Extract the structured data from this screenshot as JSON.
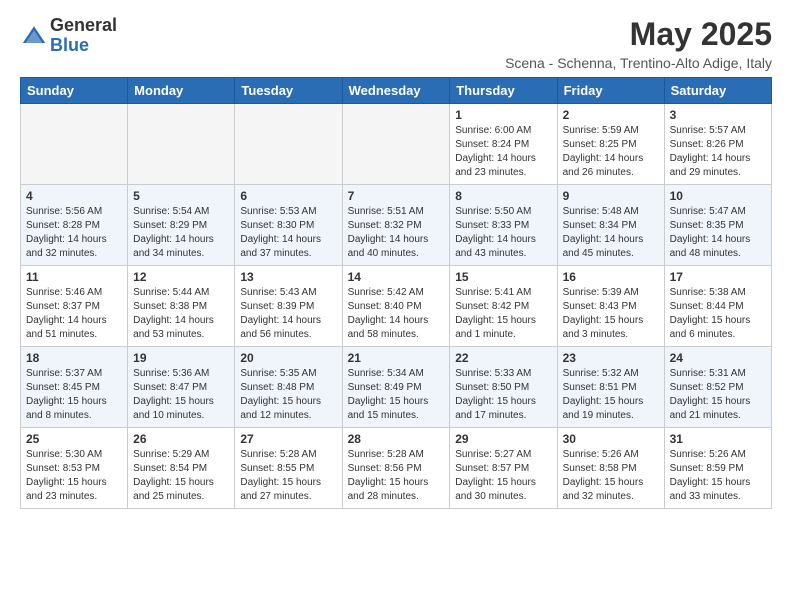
{
  "logo": {
    "general": "General",
    "blue": "Blue"
  },
  "header": {
    "month_title": "May 2025",
    "subtitle": "Scena - Schenna, Trentino-Alto Adige, Italy"
  },
  "weekdays": [
    "Sunday",
    "Monday",
    "Tuesday",
    "Wednesday",
    "Thursday",
    "Friday",
    "Saturday"
  ],
  "weeks": [
    [
      {
        "day": "",
        "info": ""
      },
      {
        "day": "",
        "info": ""
      },
      {
        "day": "",
        "info": ""
      },
      {
        "day": "",
        "info": ""
      },
      {
        "day": "1",
        "info": "Sunrise: 6:00 AM\nSunset: 8:24 PM\nDaylight: 14 hours\nand 23 minutes."
      },
      {
        "day": "2",
        "info": "Sunrise: 5:59 AM\nSunset: 8:25 PM\nDaylight: 14 hours\nand 26 minutes."
      },
      {
        "day": "3",
        "info": "Sunrise: 5:57 AM\nSunset: 8:26 PM\nDaylight: 14 hours\nand 29 minutes."
      }
    ],
    [
      {
        "day": "4",
        "info": "Sunrise: 5:56 AM\nSunset: 8:28 PM\nDaylight: 14 hours\nand 32 minutes."
      },
      {
        "day": "5",
        "info": "Sunrise: 5:54 AM\nSunset: 8:29 PM\nDaylight: 14 hours\nand 34 minutes."
      },
      {
        "day": "6",
        "info": "Sunrise: 5:53 AM\nSunset: 8:30 PM\nDaylight: 14 hours\nand 37 minutes."
      },
      {
        "day": "7",
        "info": "Sunrise: 5:51 AM\nSunset: 8:32 PM\nDaylight: 14 hours\nand 40 minutes."
      },
      {
        "day": "8",
        "info": "Sunrise: 5:50 AM\nSunset: 8:33 PM\nDaylight: 14 hours\nand 43 minutes."
      },
      {
        "day": "9",
        "info": "Sunrise: 5:48 AM\nSunset: 8:34 PM\nDaylight: 14 hours\nand 45 minutes."
      },
      {
        "day": "10",
        "info": "Sunrise: 5:47 AM\nSunset: 8:35 PM\nDaylight: 14 hours\nand 48 minutes."
      }
    ],
    [
      {
        "day": "11",
        "info": "Sunrise: 5:46 AM\nSunset: 8:37 PM\nDaylight: 14 hours\nand 51 minutes."
      },
      {
        "day": "12",
        "info": "Sunrise: 5:44 AM\nSunset: 8:38 PM\nDaylight: 14 hours\nand 53 minutes."
      },
      {
        "day": "13",
        "info": "Sunrise: 5:43 AM\nSunset: 8:39 PM\nDaylight: 14 hours\nand 56 minutes."
      },
      {
        "day": "14",
        "info": "Sunrise: 5:42 AM\nSunset: 8:40 PM\nDaylight: 14 hours\nand 58 minutes."
      },
      {
        "day": "15",
        "info": "Sunrise: 5:41 AM\nSunset: 8:42 PM\nDaylight: 15 hours\nand 1 minute."
      },
      {
        "day": "16",
        "info": "Sunrise: 5:39 AM\nSunset: 8:43 PM\nDaylight: 15 hours\nand 3 minutes."
      },
      {
        "day": "17",
        "info": "Sunrise: 5:38 AM\nSunset: 8:44 PM\nDaylight: 15 hours\nand 6 minutes."
      }
    ],
    [
      {
        "day": "18",
        "info": "Sunrise: 5:37 AM\nSunset: 8:45 PM\nDaylight: 15 hours\nand 8 minutes."
      },
      {
        "day": "19",
        "info": "Sunrise: 5:36 AM\nSunset: 8:47 PM\nDaylight: 15 hours\nand 10 minutes."
      },
      {
        "day": "20",
        "info": "Sunrise: 5:35 AM\nSunset: 8:48 PM\nDaylight: 15 hours\nand 12 minutes."
      },
      {
        "day": "21",
        "info": "Sunrise: 5:34 AM\nSunset: 8:49 PM\nDaylight: 15 hours\nand 15 minutes."
      },
      {
        "day": "22",
        "info": "Sunrise: 5:33 AM\nSunset: 8:50 PM\nDaylight: 15 hours\nand 17 minutes."
      },
      {
        "day": "23",
        "info": "Sunrise: 5:32 AM\nSunset: 8:51 PM\nDaylight: 15 hours\nand 19 minutes."
      },
      {
        "day": "24",
        "info": "Sunrise: 5:31 AM\nSunset: 8:52 PM\nDaylight: 15 hours\nand 21 minutes."
      }
    ],
    [
      {
        "day": "25",
        "info": "Sunrise: 5:30 AM\nSunset: 8:53 PM\nDaylight: 15 hours\nand 23 minutes."
      },
      {
        "day": "26",
        "info": "Sunrise: 5:29 AM\nSunset: 8:54 PM\nDaylight: 15 hours\nand 25 minutes."
      },
      {
        "day": "27",
        "info": "Sunrise: 5:28 AM\nSunset: 8:55 PM\nDaylight: 15 hours\nand 27 minutes."
      },
      {
        "day": "28",
        "info": "Sunrise: 5:28 AM\nSunset: 8:56 PM\nDaylight: 15 hours\nand 28 minutes."
      },
      {
        "day": "29",
        "info": "Sunrise: 5:27 AM\nSunset: 8:57 PM\nDaylight: 15 hours\nand 30 minutes."
      },
      {
        "day": "30",
        "info": "Sunrise: 5:26 AM\nSunset: 8:58 PM\nDaylight: 15 hours\nand 32 minutes."
      },
      {
        "day": "31",
        "info": "Sunrise: 5:26 AM\nSunset: 8:59 PM\nDaylight: 15 hours\nand 33 minutes."
      }
    ]
  ]
}
